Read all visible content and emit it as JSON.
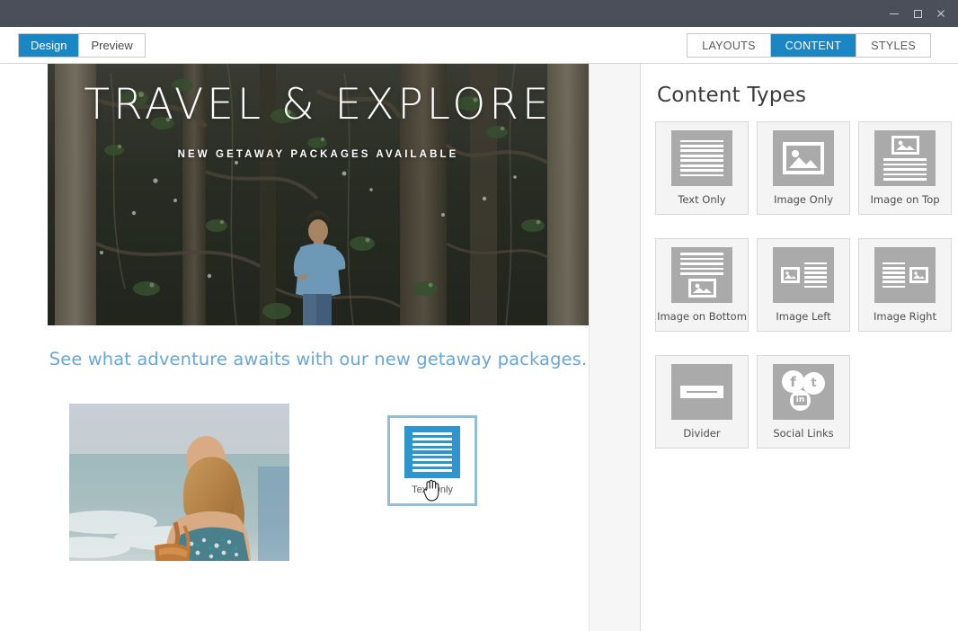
{
  "window": {
    "controls": [
      {
        "name": "minimize",
        "glyph": "minimize-icon"
      },
      {
        "name": "maximize",
        "glyph": "maximize-icon"
      },
      {
        "name": "close",
        "glyph": "close-icon"
      }
    ]
  },
  "toolbar": {
    "left_tabs": [
      {
        "label": "Design",
        "active": true
      },
      {
        "label": "Preview",
        "active": false
      }
    ],
    "right_tabs": [
      {
        "label": "LAYOUTS",
        "active": false
      },
      {
        "label": "CONTENT",
        "active": true
      },
      {
        "label": "STYLES",
        "active": false
      }
    ],
    "accent_color": "#1a87c4"
  },
  "canvas": {
    "hero": {
      "title": "TRAVEL & EXPLORE",
      "subtitle": "NEW GETAWAY PACKAGES AVAILABLE",
      "image_alt": "forest-trees-photo"
    },
    "tagline": "See what adventure awaits with our new getaway packages.",
    "tagline_color": "#6aa6d9",
    "photo_alt": "woman-at-beach-photo",
    "drag_tile": {
      "label": "Text Only",
      "icon": "text-lines-icon",
      "icon_color": "#2f95cd",
      "highlight_color": "#93bed8"
    },
    "cursor": "grab-hand-cursor"
  },
  "panel": {
    "title": "Content Types",
    "tiles": [
      {
        "label": "Text Only",
        "icon": "text-lines-icon"
      },
      {
        "label": "Image Only",
        "icon": "picture-icon"
      },
      {
        "label": "Image on Top",
        "icon": "picture-above-text-icon"
      },
      {
        "label": "Image on Bottom",
        "icon": "text-above-picture-icon"
      },
      {
        "label": "Image Left",
        "icon": "picture-left-text-icon"
      },
      {
        "label": "Image Right",
        "icon": "text-left-picture-icon"
      },
      {
        "label": "Divider",
        "icon": "divider-icon"
      },
      {
        "label": "Social Links",
        "icon": "social-links-icon"
      }
    ],
    "social_glyphs": {
      "facebook": "f",
      "twitter": "t",
      "linkedin": "in"
    }
  }
}
